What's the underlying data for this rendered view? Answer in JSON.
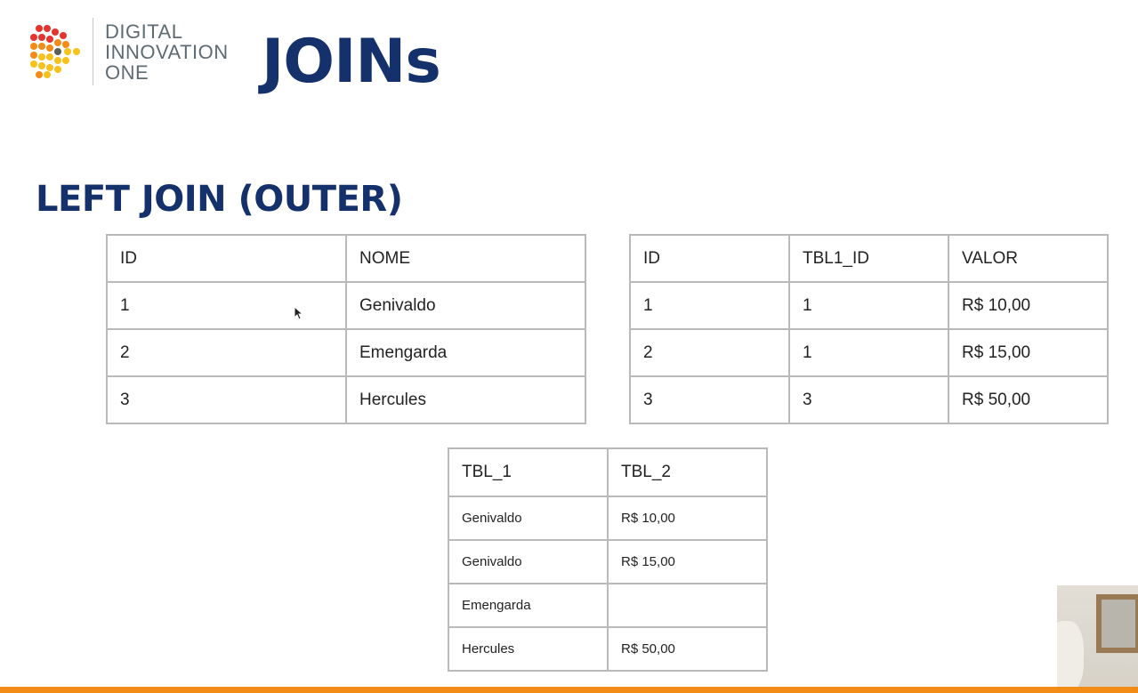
{
  "header": {
    "brand_lines": [
      "DIGITAL",
      "INNOVATION",
      "ONE"
    ],
    "title": "JOINs"
  },
  "section": {
    "title": "LEFT JOIN (OUTER)"
  },
  "table1": {
    "headers": [
      "ID",
      "NOME"
    ],
    "rows": [
      [
        "1",
        "Genivaldo"
      ],
      [
        "2",
        "Emengarda"
      ],
      [
        "3",
        "Hercules"
      ]
    ]
  },
  "table2": {
    "headers": [
      "ID",
      "TBL1_ID",
      "VALOR"
    ],
    "rows": [
      [
        "1",
        "1",
        "R$ 10,00"
      ],
      [
        "2",
        "1",
        "R$ 15,00"
      ],
      [
        "3",
        "3",
        "R$ 50,00"
      ]
    ]
  },
  "result": {
    "headers": [
      "TBL_1",
      "TBL_2"
    ],
    "rows": [
      [
        "Genivaldo",
        "R$ 10,00"
      ],
      [
        "Genivaldo",
        "R$ 15,00"
      ],
      [
        "Emengarda",
        ""
      ],
      [
        "Hercules",
        "R$ 50,00"
      ]
    ]
  },
  "colors": {
    "title": "#15316b",
    "accent_bar": "#f28c17",
    "logo_red": "#e3342f",
    "logo_orange": "#f28c17",
    "logo_yellow": "#f7c21b"
  },
  "icons": {
    "logo": "digital-innovation-one-logo-icon",
    "cursor": "mouse-cursor-icon"
  }
}
